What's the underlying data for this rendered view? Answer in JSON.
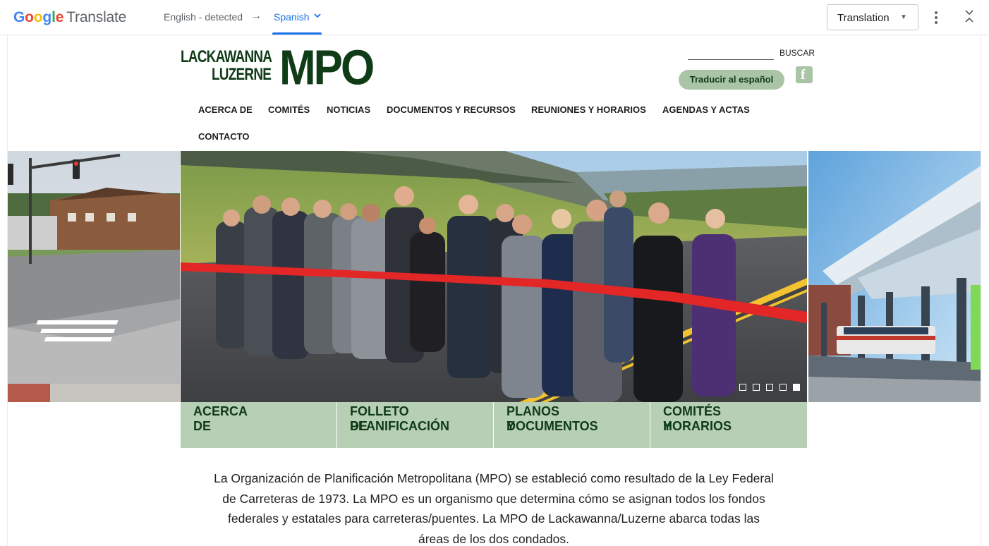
{
  "translate_bar": {
    "logo_google": "Google",
    "logo_translate": "Translate",
    "source_language": "English - detected",
    "arrow": "→",
    "target_language": "Spanish",
    "mode_select": "Translation",
    "icons": [
      "chevron-down-icon",
      "more-vert-icon",
      "collapse-icon"
    ]
  },
  "site": {
    "logo_line1": "LACKAWANNA",
    "logo_line2": "LUZERNE",
    "logo_big": "MPO",
    "search_button": "BUSCAR",
    "translate_button": "Traducir al español",
    "facebook_glyph": "f",
    "nav": [
      "ACERCA DE",
      "COMITÉS",
      "NOTICIAS",
      "DOCUMENTOS Y RECURSOS",
      "REUNIONES Y HORARIOS",
      "AGENDAS Y ACTAS",
      "CONTACTO"
    ],
    "slider": {
      "total_slides": 5,
      "active_slide": 5
    },
    "quick_links": [
      {
        "line1": "",
        "line2": "ACERCA DE"
      },
      {
        "line1": "FOLLETO DE",
        "line2": "PLANIFICACIÓN"
      },
      {
        "line1": "PLANOS Y",
        "line2": "DOCUMENTOS"
      },
      {
        "line1": "COMITÉS Y",
        "line2": "HORARIOS"
      }
    ],
    "intro_lines": [
      "La Organización de Planificación Metropolitana (MPO) se estableció como resultado de la Ley Federal",
      "de Carreteras de 1973. La MPO es un organismo que determina cómo se asignan todos los fondos",
      "federales y estatales para carreteras/puentes. La MPO de Lackawanna/Luzerne abarca todas las",
      "áreas de los dos condados."
    ]
  },
  "colors": {
    "brand_green": "#0f3b17",
    "button_green": "#a9c5a6",
    "quick_bg": "#b7cfb5",
    "google_blue": "#1a73e8",
    "ribbon_red": "#e32626"
  }
}
